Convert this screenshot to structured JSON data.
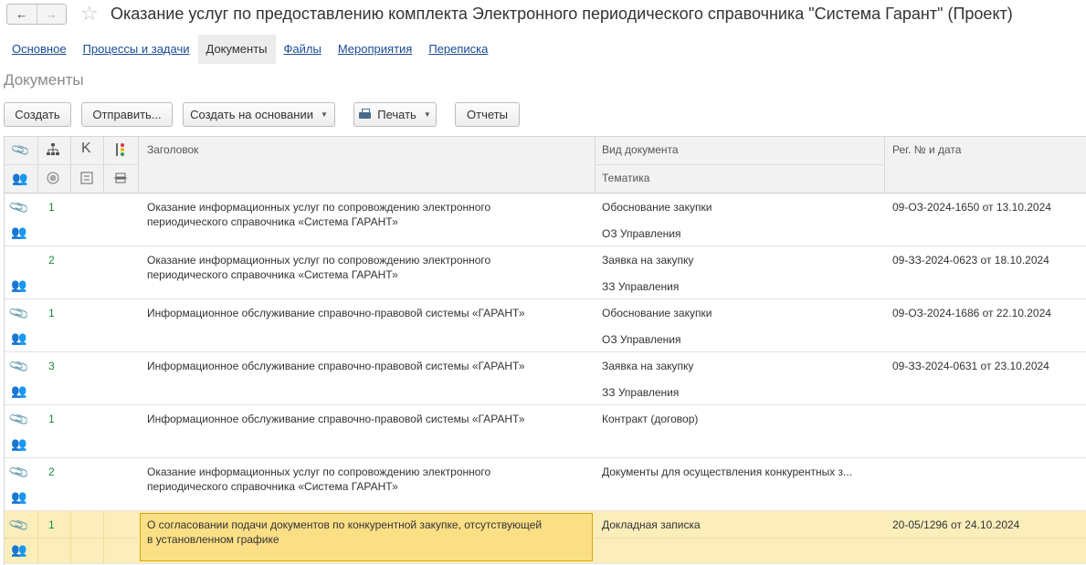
{
  "window": {
    "title": "Оказание услуг по предоставлению комплекта Электронного периодического справочника \"Система Гарант\" (Проект)",
    "back_icon": "arrow-left-icon",
    "forward_icon": "arrow-right-icon",
    "favorite_icon": "star-icon"
  },
  "tabs": [
    {
      "label": "Основное"
    },
    {
      "label": "Процессы и задачи"
    },
    {
      "label": "Документы",
      "active": true
    },
    {
      "label": "Файлы"
    },
    {
      "label": "Мероприятия"
    },
    {
      "label": "Переписка"
    }
  ],
  "section_title": "Документы",
  "toolbar": {
    "create": "Создать",
    "send": "Отправить...",
    "create_based_on": "Создать на основании",
    "print": "Печать",
    "reports": "Отчеты"
  },
  "table": {
    "headers": {
      "title": "Заголовок",
      "doc_type": "Вид документа",
      "topic": "Тематика",
      "reg": "Рег. № и дата",
      "k": "K"
    },
    "rows": [
      {
        "num": "1",
        "title": "Оказание информационных услуг по сопровождению электронного периодического справочника «Система ГАРАНТ»",
        "doc_type": "Обоснование закупки",
        "topic": "ОЗ Управления",
        "reg": "09-ОЗ-2024-1650 от 13.10.2024",
        "clip": true,
        "people": "gray"
      },
      {
        "num": "2",
        "title": "Оказание информационных услуг по сопровождению электронного периодического справочника «Система ГАРАНТ»",
        "doc_type": "Заявка на закупку",
        "topic": "ЗЗ Управления",
        "reg": "09-ЗЗ-2024-0623 от 18.10.2024",
        "clip": false,
        "people": "gray"
      },
      {
        "num": "1",
        "title": "Информационное обслуживание справочно-правовой системы «ГАРАНТ»",
        "doc_type": "Обоснование закупки",
        "topic": "ОЗ Управления",
        "reg": "09-ОЗ-2024-1686 от 22.10.2024",
        "clip": true,
        "people": "gray"
      },
      {
        "num": "3",
        "title": "Информационное обслуживание справочно-правовой системы «ГАРАНТ»",
        "doc_type": "Заявка на закупку",
        "topic": "ЗЗ Управления",
        "reg": "09-ЗЗ-2024-0631 от 23.10.2024",
        "clip": true,
        "people": "gray"
      },
      {
        "num": "1",
        "title": "Информационное обслуживание справочно-правовой системы «ГАРАНТ»",
        "doc_type": "Контракт (договор)",
        "topic": "",
        "reg": "",
        "clip": true,
        "people": "green"
      },
      {
        "num": "2",
        "title": "Оказание информационных услуг по сопровождению электронного периодического справочника «Система ГАРАНТ»",
        "doc_type": "Документы для осуществления конкурентных з...",
        "topic": "",
        "reg": "",
        "clip": true,
        "people": "green"
      },
      {
        "num": "1",
        "title": "О согласовании подачи документов по конкурентной закупке, отсутствующей в установленном графике",
        "doc_type": "Докладная записка",
        "topic": "",
        "reg": "20-05/1296 от 24.10.2024",
        "clip": true,
        "people": "gray",
        "selected": true
      }
    ]
  },
  "colors": {
    "link": "#1a4b96",
    "accent_green": "#1b8a3a",
    "selection": "#fbeebb",
    "selection_border": "#e0a700"
  }
}
